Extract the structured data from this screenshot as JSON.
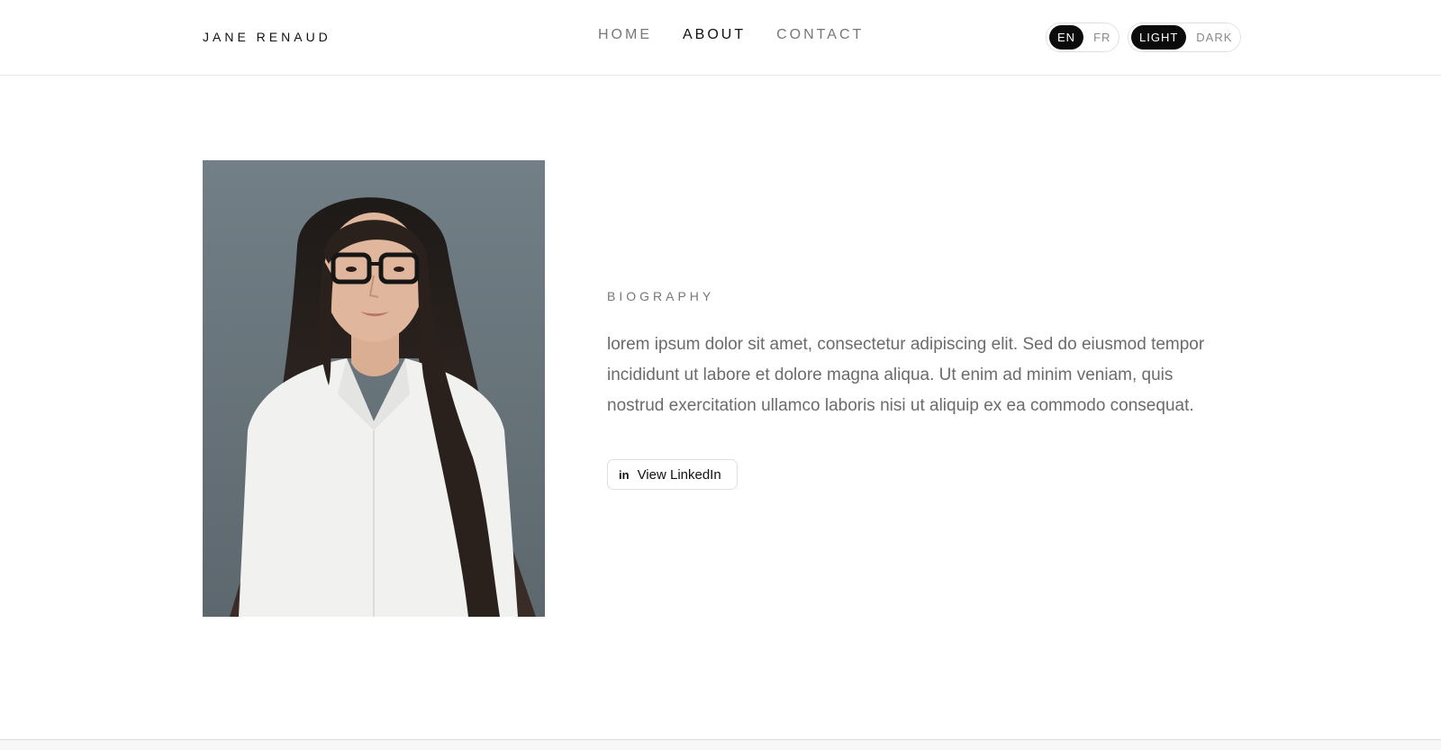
{
  "header": {
    "brand": "JANE RENAUD",
    "nav": [
      {
        "label": "HOME"
      },
      {
        "label": "ABOUT"
      },
      {
        "label": "CONTACT"
      }
    ],
    "language_toggle": {
      "options": [
        "EN",
        "FR"
      ],
      "selected": "EN"
    },
    "theme_toggle": {
      "options": [
        "LIGHT",
        "DARK"
      ],
      "selected": "LIGHT"
    }
  },
  "about": {
    "section_label": "BIOGRAPHY",
    "text": "lorem ipsum dolor sit amet, consectetur adipiscing elit. Sed do eiusmod tempor incididunt ut labore et dolore magna aliqua. Ut enim ad minim veniam, quis nostrud exercitation ullamco laboris nisi ut aliquip ex ea commodo consequat.",
    "linkedin_button": {
      "icon": "linkedin-icon",
      "label": "View LinkedIn"
    }
  },
  "colors": {
    "accent": "#0b0b0b",
    "text_muted": "#6b6b6b"
  }
}
